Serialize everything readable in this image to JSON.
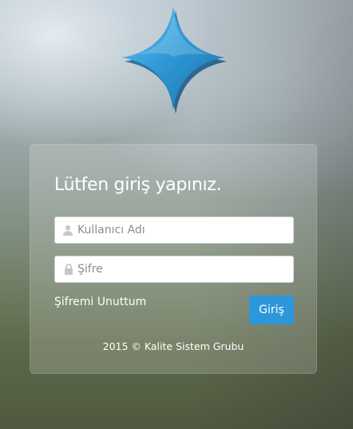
{
  "logo": {
    "icon": "four-point-star-logo",
    "color": "#2d97db"
  },
  "login": {
    "title": "Lütfen giriş yapınız.",
    "username": {
      "placeholder": "Kullanıcı Adı",
      "value": "",
      "icon": "user-icon"
    },
    "password": {
      "placeholder": "Şifre",
      "value": "",
      "icon": "lock-icon"
    },
    "forgot_label": "Şifremi Unuttum",
    "submit_label": "Giriş",
    "submit_color": "#2d97db",
    "footer": "2015 © Kalite Sistem Grubu"
  }
}
